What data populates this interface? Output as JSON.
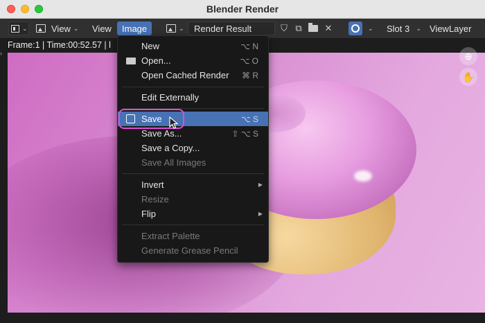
{
  "window": {
    "title": "Blender Render"
  },
  "header": {
    "view_menu": "View",
    "view_btn": "View",
    "image_menu": "Image",
    "image_name": "Render Result",
    "slot": "Slot 3",
    "view_layer": "ViewLayer"
  },
  "status": {
    "text": "Frame:1 | Time:00:52.57 | l"
  },
  "menu": {
    "items": [
      {
        "label": "New",
        "shortcut": "⌥ N"
      },
      {
        "label": "Open...",
        "shortcut": "⌥ O"
      },
      {
        "label": "Open Cached Render",
        "shortcut": "⌘ R"
      },
      {
        "label": "Edit Externally",
        "shortcut": ""
      },
      {
        "label": "Save",
        "shortcut": "⌥ S"
      },
      {
        "label": "Save As...",
        "shortcut": "⇧ ⌥ S"
      },
      {
        "label": "Save a Copy...",
        "shortcut": ""
      },
      {
        "label": "Save All Images",
        "shortcut": ""
      },
      {
        "label": "Invert",
        "shortcut": ""
      },
      {
        "label": "Resize",
        "shortcut": ""
      },
      {
        "label": "Flip",
        "shortcut": ""
      },
      {
        "label": "Extract Palette",
        "shortcut": ""
      },
      {
        "label": "Generate Grease Pencil",
        "shortcut": ""
      }
    ]
  },
  "colors": {
    "accent": "#4772b3",
    "highlight_ring": "#e64ad4"
  },
  "icons": [
    "editor-type-icon",
    "image-icon",
    "shield-icon",
    "copy-icon",
    "folder-icon",
    "close-icon",
    "overlay-icon",
    "zoom-icon",
    "hand-icon",
    "cursor-icon"
  ]
}
